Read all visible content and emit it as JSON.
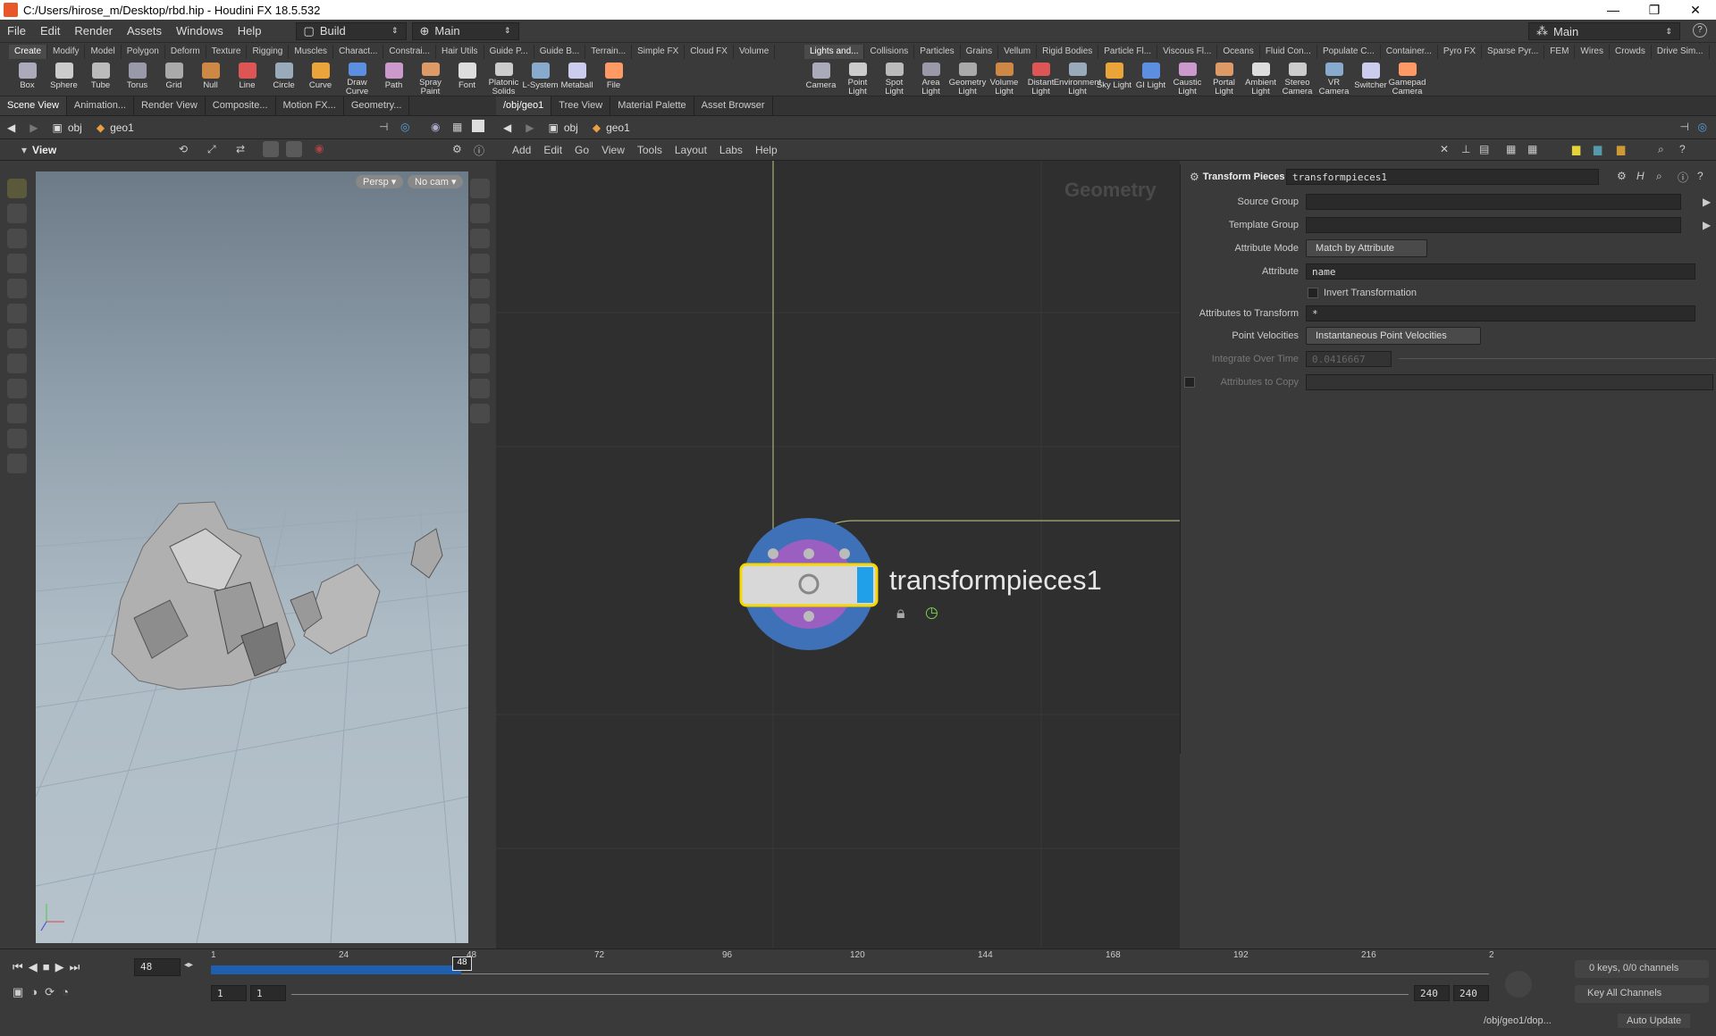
{
  "window": {
    "title": "C:/Users/hirose_m/Desktop/rbd.hip - Houdini FX 18.5.532"
  },
  "menubar": {
    "items": [
      "File",
      "Edit",
      "Render",
      "Assets",
      "Windows",
      "Help"
    ],
    "build_label": "Build",
    "desktop_label": "Main",
    "right_desktop": "Main"
  },
  "shelf_left": {
    "tabs": [
      "Create",
      "Modify",
      "Model",
      "Polygon",
      "Deform",
      "Texture",
      "Rigging",
      "Muscles",
      "Charact...",
      "Constrai...",
      "Hair Utils",
      "Guide P...",
      "Guide B...",
      "Terrain...",
      "Simple FX",
      "Cloud FX",
      "Volume"
    ],
    "tools": [
      "Box",
      "Sphere",
      "Tube",
      "Torus",
      "Grid",
      "Null",
      "Line",
      "Circle",
      "Curve",
      "Draw Curve",
      "Path",
      "Spray Paint",
      "Font",
      "Platonic Solids",
      "L-System",
      "Metaball",
      "File"
    ]
  },
  "shelf_right": {
    "tabs": [
      "Lights and...",
      "Collisions",
      "Particles",
      "Grains",
      "Vellum",
      "Rigid Bodies",
      "Particle Fl...",
      "Viscous Fl...",
      "Oceans",
      "Fluid Con...",
      "Populate C...",
      "Container...",
      "Pyro FX",
      "Sparse Pyr...",
      "FEM",
      "Wires",
      "Crowds",
      "Drive Sim..."
    ],
    "tools": [
      "Camera",
      "Point Light",
      "Spot Light",
      "Area Light",
      "Geometry Light",
      "Volume Light",
      "Distant Light",
      "Environment Light",
      "Sky Light",
      "GI Light",
      "Caustic Light",
      "Portal Light",
      "Ambient Light",
      "Stereo Camera",
      "VR Camera",
      "Switcher",
      "Gamepad Camera"
    ]
  },
  "pane_tabs_left": [
    "Scene View",
    "Animation...",
    "Render View",
    "Composite...",
    "Motion FX...",
    "Geometry..."
  ],
  "pane_tabs_right": [
    "/obj/geo1",
    "Tree View",
    "Material Palette",
    "Asset Browser"
  ],
  "path": {
    "root": "obj",
    "node": "geo1"
  },
  "viewer": {
    "label": "View",
    "persp": "Persp ▾",
    "cam": "No cam ▾"
  },
  "network": {
    "menu": [
      "Add",
      "Edit",
      "Go",
      "View",
      "Tools",
      "Layout",
      "Labs",
      "Help"
    ],
    "context_label": "Geometry",
    "node_name": "transformpieces1"
  },
  "params": {
    "node_type": "Transform Pieces",
    "node_name": "transformpieces1",
    "source_group_label": "Source Group",
    "template_group_label": "Template Group",
    "attribute_mode_label": "Attribute Mode",
    "attribute_mode_value": "Match by Attribute",
    "attribute_label": "Attribute",
    "attribute_value": "name",
    "invert_label": "Invert Transformation",
    "attrs_transform_label": "Attributes to Transform",
    "attrs_transform_value": "*",
    "point_vel_label": "Point Velocities",
    "point_vel_value": "Instantaneous Point Velocities",
    "integrate_label": "Integrate Over Time",
    "integrate_value": "0.0416667",
    "attrs_copy_label": "Attributes to Copy"
  },
  "timeline": {
    "current_frame": "48",
    "ticks": [
      "1",
      "24",
      "48",
      "72",
      "96",
      "120",
      "144",
      "168",
      "192",
      "216",
      "2"
    ],
    "start": "1",
    "start2": "1",
    "end": "240",
    "end2": "240",
    "keys_label": "0 keys, 0/0 channels",
    "key_all": "Key All Channels",
    "status_path": "/obj/geo1/dop...",
    "auto_update": "Auto Update"
  },
  "colors": {
    "accent": "#3a7bd5",
    "node_selected": "#f5d800",
    "playbar": "#1f5fae"
  }
}
